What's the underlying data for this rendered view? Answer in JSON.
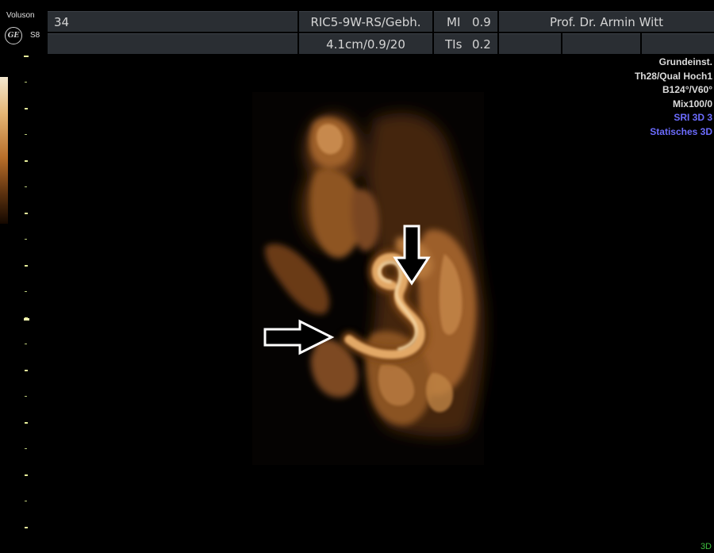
{
  "header": {
    "brand": "Voluson",
    "model": "S8",
    "logo_text": "GE",
    "frame_number": "34",
    "probe_label": "RIC5-9W-RS/Gebh.",
    "depth_info": "4.1cm/0.9/20",
    "mi_label": "MI",
    "mi_value": "0.9",
    "tis_label": "TIs",
    "tis_value": "0.2",
    "operator": "Prof. Dr. Armin Witt"
  },
  "info_panel": {
    "lines": [
      {
        "text": "Grundeinst.",
        "color": "#dcdcdc"
      },
      {
        "text": "Th28/Qual Hoch1",
        "color": "#dcdcdc"
      },
      {
        "text": "B124°/V60°",
        "color": "#dcdcdc"
      },
      {
        "text": "Mix100/0",
        "color": "#dcdcdc"
      },
      {
        "text": "SRI 3D 3",
        "color": "#6c6cff"
      },
      {
        "text": "Statisches 3D",
        "color": "#6c6cff"
      }
    ]
  },
  "mode_indicator": "3D",
  "image": {
    "description_icon": "ultrasound-3d-render",
    "arrows": [
      "arrow-down-icon",
      "arrow-right-icon"
    ]
  },
  "colors": {
    "tissue": "#c8874a",
    "tissue_bright": "#f0c98f",
    "header_cell": "#2a2e33",
    "scale_marker": "#e6ee9a",
    "info_blue": "#6c6cff",
    "mode_green": "#3fbf3f"
  }
}
